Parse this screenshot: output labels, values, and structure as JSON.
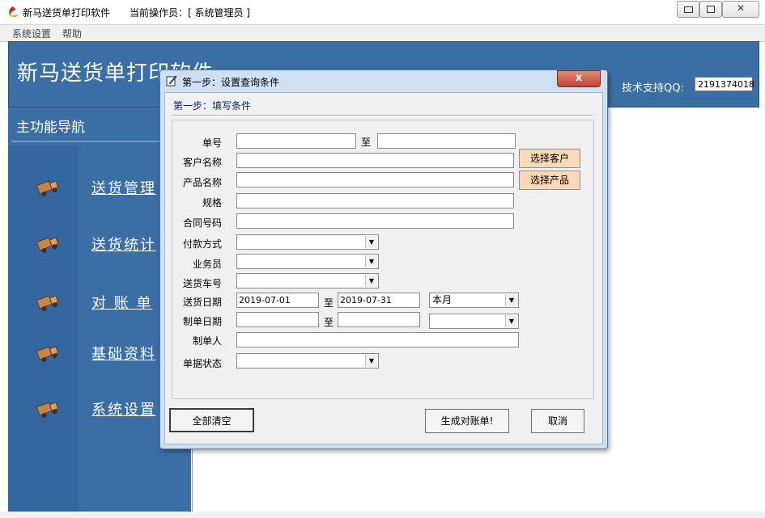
{
  "window": {
    "title": "新马送货单打印软件",
    "operator": "当前操作员：[ 系统管理员 ]",
    "minimize": "▭",
    "maximize": "◻",
    "close": "✕"
  },
  "menu": {
    "items": [
      "系统设置",
      "帮助"
    ]
  },
  "header": {
    "big_title": "新马送货单打印软件",
    "support_label": "技术支持QQ:",
    "support_qq": "2191374018"
  },
  "nav": {
    "title": "主功能导航",
    "items": [
      {
        "label": "送货管理",
        "icon": "truck-icon"
      },
      {
        "label": "送货统计",
        "icon": "truck-icon"
      },
      {
        "label": "对 账 单",
        "icon": "truck-icon"
      },
      {
        "label": "基础资料",
        "icon": "truck-icon"
      },
      {
        "label": "系统设置",
        "icon": "truck-icon"
      }
    ]
  },
  "dialog": {
    "title": "第一步：设置查询条件",
    "close": "x",
    "step": "第一步：填写条件",
    "fields": {
      "order_no": "单号",
      "to1": "至",
      "customer": "客户名称",
      "product": "产品名称",
      "spec": "规格",
      "contract": "合同号码",
      "payment": "付款方式",
      "salesman": "业务员",
      "truck": "送货车号",
      "ship_date": "送货日期",
      "ship_from": "2019-07-01",
      "to2": "至",
      "ship_to": "2019-07-31",
      "period": "本月",
      "make_date": "制单日期",
      "to3": "至",
      "maker": "制单人",
      "status": "单据状态"
    },
    "buttons": {
      "choose_customer": "选择客户",
      "choose_product": "选择产品",
      "clear_all": "全部清空",
      "generate": "生成对账单!",
      "cancel": "取消"
    }
  },
  "colors": {
    "accent": "#3a6ea5",
    "dialog_frame": "#cfe0f2",
    "select_button": "#fbd9b8"
  }
}
